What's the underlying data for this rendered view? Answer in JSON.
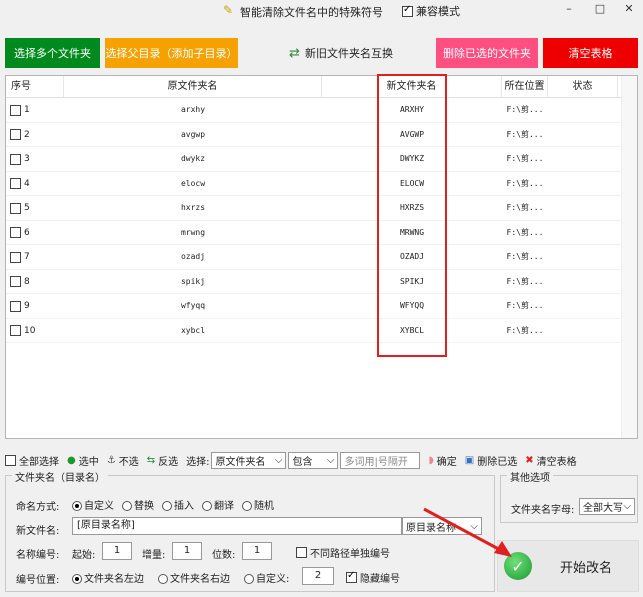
{
  "window": {
    "title": "智能清除文件名中的特殊符号",
    "compat_label": "兼容模式",
    "compat_checked": true,
    "min_glyph": "–",
    "max_glyph": "□",
    "close_glyph": "✕"
  },
  "toolbar": {
    "select_multi": "选择多个文件夹",
    "select_parent": "选择父目录（添加子目录）",
    "swap": "新旧文件夹名互换",
    "delete_selected": "删除已选的文件夹",
    "clear_table": "清空表格"
  },
  "table": {
    "headers": {
      "seq": "序号",
      "original": "原文件夹名",
      "new": "新文件夹名",
      "location": "所在位置",
      "status": "状态"
    },
    "rows": [
      {
        "seq": "1",
        "original": "arxhy",
        "new": "ARXHY",
        "location": "F:\\剪..."
      },
      {
        "seq": "2",
        "original": "avgwp",
        "new": "AVGWP",
        "location": "F:\\剪..."
      },
      {
        "seq": "3",
        "original": "dwykz",
        "new": "DWYKZ",
        "location": "F:\\剪..."
      },
      {
        "seq": "4",
        "original": "elocw",
        "new": "ELOCW",
        "location": "F:\\剪..."
      },
      {
        "seq": "5",
        "original": "hxrzs",
        "new": "HXRZS",
        "location": "F:\\剪..."
      },
      {
        "seq": "6",
        "original": "mrwng",
        "new": "MRWNG",
        "location": "F:\\剪..."
      },
      {
        "seq": "7",
        "original": "ozadj",
        "new": "OZADJ",
        "location": "F:\\剪..."
      },
      {
        "seq": "8",
        "original": "spikj",
        "new": "SPIKJ",
        "location": "F:\\剪..."
      },
      {
        "seq": "9",
        "original": "wfyqq",
        "new": "WFYQQ",
        "location": "F:\\剪..."
      },
      {
        "seq": "10",
        "original": "xybcl",
        "new": "XYBCL",
        "location": "F:\\剪..."
      }
    ]
  },
  "filter": {
    "select_all": "全部选择",
    "select": "选中",
    "deselect": "不选",
    "invert": "反选",
    "choose_label": "选择:",
    "field_value": "原文件夹名",
    "match_value": "包含",
    "keyword_placeholder": "多词用|号隔开",
    "confirm": "确定",
    "delete_selected": "删除已选",
    "clear_table": "清空表格"
  },
  "options": {
    "legend": "文件夹名（目录名）",
    "naming_label": "命名方式:",
    "naming_modes": [
      "自定义",
      "替换",
      "插入",
      "翻译",
      "随机"
    ],
    "naming_selected": "自定义",
    "new_name_label": "新文件名:",
    "new_name_value": "[原目录名称]",
    "new_name_select": "原目录名称",
    "numbering_label": "名称编号:",
    "start_label": "起始:",
    "start_value": "1",
    "increment_label": "增量:",
    "increment_value": "1",
    "digits_label": "位数:",
    "digits_value": "1",
    "separate_label": "不同路径单独编号",
    "separate_checked": false,
    "position_label": "编号位置:",
    "positions": [
      "文件夹名左边",
      "文件夹名右边",
      "自定义:"
    ],
    "position_selected": "文件夹名左边",
    "custom_pos_value": "2",
    "hide_number_label": "隐藏编号",
    "hide_number_checked": true
  },
  "other": {
    "legend": "其他选项",
    "case_label": "文件夹名字母:",
    "case_value": "全部大写"
  },
  "start": {
    "label": "开始改名"
  },
  "colors": {
    "green": "#008a1e",
    "orange": "#f5a200",
    "pink": "#ff4f81",
    "red": "#ee0000",
    "highlight": "#e02020"
  }
}
